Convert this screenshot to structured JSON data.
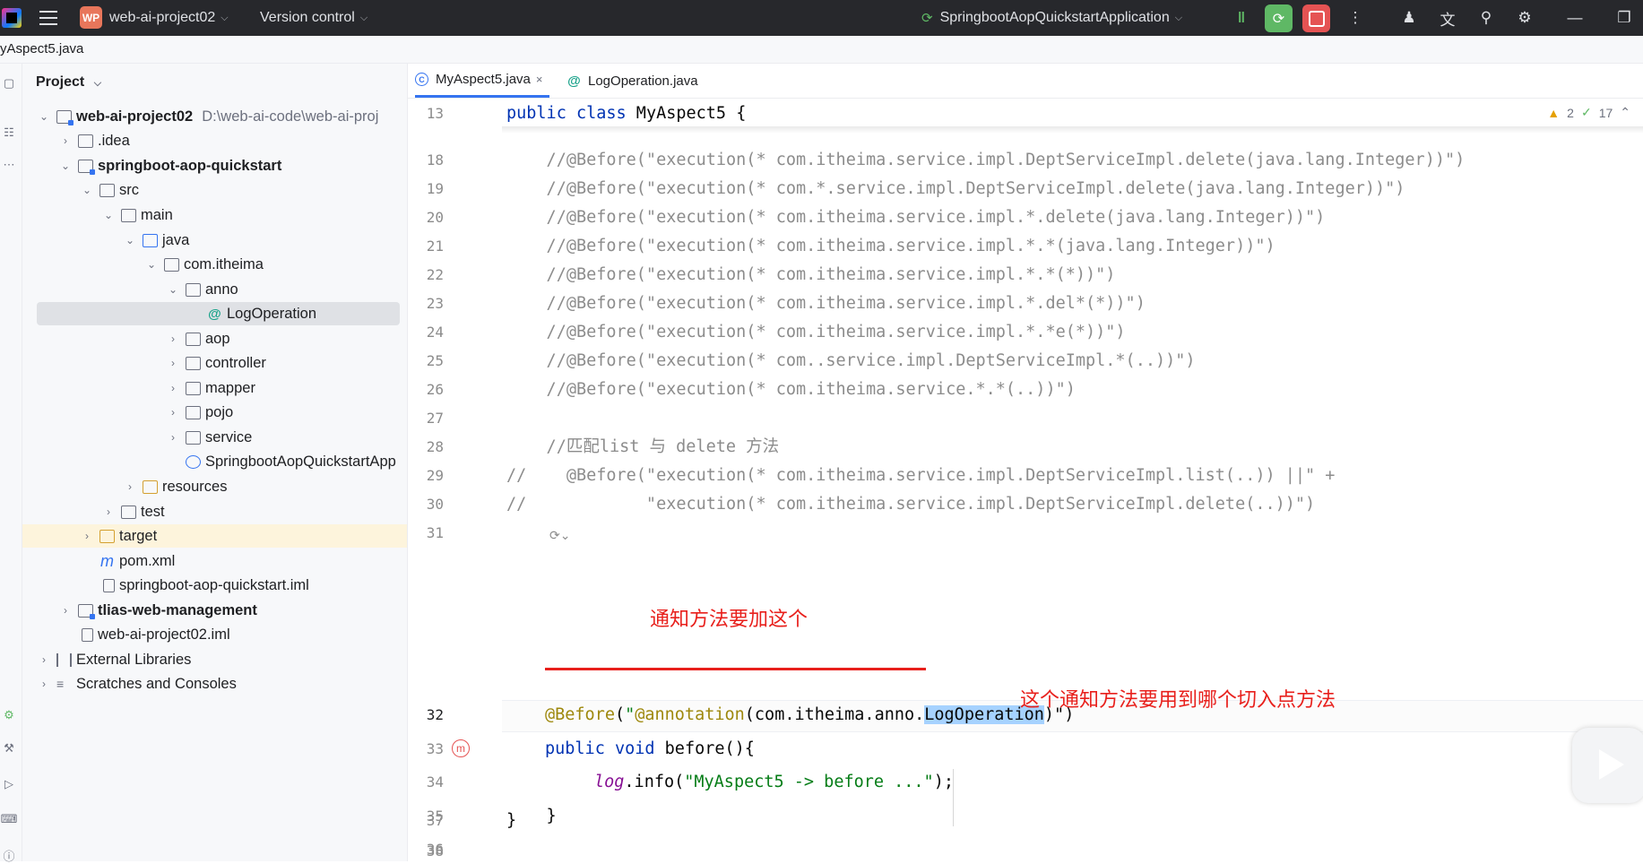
{
  "titlebar": {
    "project_badge": "WP",
    "project_name": "web-ai-project02",
    "vcs_label": "Version control",
    "run_config": "SpringbootAopQuickstartApplication"
  },
  "breadcrumb": {
    "file": "yAspect5.java"
  },
  "project_panel": {
    "title": "Project",
    "tree": [
      {
        "label": "web-ai-project02",
        "path": "D:\\web-ai-code\\web-ai-proj"
      },
      {
        "label": ".idea"
      },
      {
        "label": "springboot-aop-quickstart"
      },
      {
        "label": "src"
      },
      {
        "label": "main"
      },
      {
        "label": "java"
      },
      {
        "label": "com.itheima"
      },
      {
        "label": "anno"
      },
      {
        "label": "LogOperation"
      },
      {
        "label": "aop"
      },
      {
        "label": "controller"
      },
      {
        "label": "mapper"
      },
      {
        "label": "pojo"
      },
      {
        "label": "service"
      },
      {
        "label": "SpringbootAopQuickstartApp"
      },
      {
        "label": "resources"
      },
      {
        "label": "test"
      },
      {
        "label": "target"
      },
      {
        "label": "pom.xml"
      },
      {
        "label": "springboot-aop-quickstart.iml"
      },
      {
        "label": "tlias-web-management"
      },
      {
        "label": "web-ai-project02.iml"
      },
      {
        "label": "External Libraries"
      },
      {
        "label": "Scratches and Consoles"
      }
    ]
  },
  "tabs": [
    {
      "label": "MyAspect5.java",
      "close": "×"
    },
    {
      "label": "LogOperation.java"
    }
  ],
  "inspections": {
    "warnings": "2",
    "ok": "17"
  },
  "code": {
    "sticky_line_no": "13",
    "sticky_kw1": "public",
    "sticky_kw2": "class",
    "sticky_rest": " MyAspect5 {",
    "lines": [
      {
        "n": "18",
        "text": "    //@Before(\"execution(* com.itheima.service.impl.DeptServiceImpl.delete(java.lang.Integer))\")"
      },
      {
        "n": "19",
        "text": "    //@Before(\"execution(* com.*.service.impl.DeptServiceImpl.delete(java.lang.Integer))\")"
      },
      {
        "n": "20",
        "text": "    //@Before(\"execution(* com.itheima.service.impl.*.delete(java.lang.Integer))\")"
      },
      {
        "n": "21",
        "text": "    //@Before(\"execution(* com.itheima.service.impl.*.*(java.lang.Integer))\")"
      },
      {
        "n": "22",
        "text": "    //@Before(\"execution(* com.itheima.service.impl.*.*(*))\")"
      },
      {
        "n": "23",
        "text": "    //@Before(\"execution(* com.itheima.service.impl.*.del*(*))\")"
      },
      {
        "n": "24",
        "text": "    //@Before(\"execution(* com.itheima.service.impl.*.*e(*))\")"
      },
      {
        "n": "25",
        "text": "    //@Before(\"execution(* com..service.impl.DeptServiceImpl.*(..))\")"
      },
      {
        "n": "26",
        "text": "    //@Before(\"execution(* com.itheima.service.*.*(..))\")"
      },
      {
        "n": "27",
        "text": ""
      },
      {
        "n": "28",
        "text": "    //匹配list 与 delete 方法"
      },
      {
        "n": "29",
        "text": "//    @Before(\"execution(* com.itheima.service.impl.DeptServiceImpl.list(..)) ||\" +"
      },
      {
        "n": "30",
        "text": "//            \"execution(* com.itheima.service.impl.DeptServiceImpl.delete(..))\")"
      },
      {
        "n": "31",
        "text": ""
      }
    ],
    "line32": {
      "n": "32",
      "anno": "@Before",
      "open": "(",
      "q": "\"",
      "inner_anno": "@annotation",
      "pkg": "(com.itheima.anno.",
      "sel": "LogOperation",
      "close": ")\")"
    },
    "line33": {
      "n": "33",
      "kw": "public void",
      "rest": " before(){"
    },
    "line34": {
      "n": "34",
      "log": "log",
      "dot": ".info(",
      "str": "\"MyAspect5 -> before ...\"",
      "end": ");"
    },
    "line35": {
      "n": "35",
      "text": "    }"
    },
    "line36": {
      "n": "36",
      "text": ""
    },
    "line37": {
      "n": "37",
      "text": "}"
    },
    "line38": {
      "n": "38",
      "text": ""
    }
  },
  "annotations": {
    "note1": "通知方法要加这个",
    "note2": "这个通知方法要用到哪个切入点方法"
  }
}
